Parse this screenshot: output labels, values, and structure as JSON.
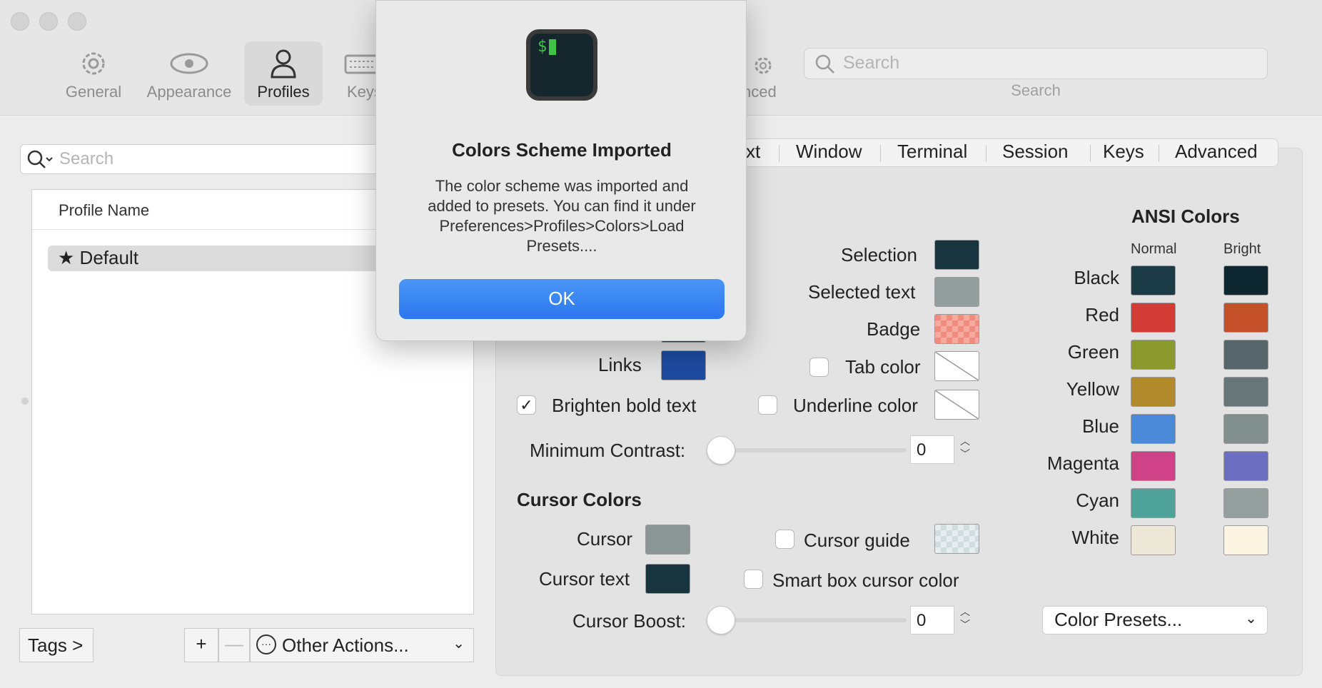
{
  "toolbar": {
    "items": [
      {
        "label": "General",
        "icon": "gear-icon"
      },
      {
        "label": "Appearance",
        "icon": "eye-icon"
      },
      {
        "label": "Profiles",
        "icon": "person-icon"
      },
      {
        "label": "Keys",
        "icon": "keyboard-icon"
      },
      {
        "label": "nced",
        "icon": "gear-icon"
      }
    ],
    "search_placeholder": "Search",
    "search_label": "Search"
  },
  "left": {
    "search_placeholder": "Search",
    "column_header": "Profile Name",
    "profiles": [
      {
        "name": "Default"
      }
    ],
    "tags_button": "Tags >",
    "add_button": "+",
    "remove_button": "—",
    "other_actions": "Other Actions..."
  },
  "tabs": [
    "xt",
    "Window",
    "Terminal",
    "Session",
    "Keys",
    "Advanced"
  ],
  "colors": {
    "links_label": "Links",
    "links_color": "#1d4ba0",
    "brighten_bold_label": "Brighten bold text",
    "brighten_bold_checked": "✓",
    "selection_label": "Selection",
    "selection_color": "#17343f",
    "selected_text_label": "Selected text",
    "selected_text_color": "#939e9e",
    "badge_label": "Badge",
    "badge_color": "#f08b7e",
    "tab_color_label": "Tab color",
    "underline_color_label": "Underline color",
    "min_contrast_label": "Minimum Contrast:",
    "min_contrast_value": "0",
    "min_contrast_level": 0
  },
  "cursor": {
    "title": "Cursor Colors",
    "cursor_label": "Cursor",
    "cursor_color": "#8a9596",
    "cursor_text_label": "Cursor text",
    "cursor_text_color": "#17343f",
    "cursor_guide_label": "Cursor guide",
    "smart_box_label": "Smart box cursor color",
    "boost_label": "Cursor Boost:",
    "boost_value": "0",
    "boost_level": 0
  },
  "ansi": {
    "title": "ANSI Colors",
    "normal_header": "Normal",
    "bright_header": "Bright",
    "rows": [
      {
        "name": "Black",
        "normal": "#1b3b47",
        "bright": "#0e2731"
      },
      {
        "name": "Red",
        "normal": "#d13c36",
        "bright": "#c4512a"
      },
      {
        "name": "Green",
        "normal": "#8a9a2c",
        "bright": "#56666b"
      },
      {
        "name": "Yellow",
        "normal": "#b08a2b",
        "bright": "#667679"
      },
      {
        "name": "Blue",
        "normal": "#4a8ad8",
        "bright": "#81908f"
      },
      {
        "name": "Magenta",
        "normal": "#cf4287",
        "bright": "#6c6fc1"
      },
      {
        "name": "Cyan",
        "normal": "#4fa29a",
        "bright": "#959f9e"
      },
      {
        "name": "White",
        "normal": "#ece7d6",
        "bright": "#fcf5e2"
      }
    ],
    "presets_label": "Color Presets..."
  },
  "dialog": {
    "icon_text": "$",
    "title": "Colors Scheme Imported",
    "message": "The color scheme was imported and added to presets. You can find it under Preferences>Profiles>Colors>Load Presets....",
    "ok_label": "OK"
  }
}
